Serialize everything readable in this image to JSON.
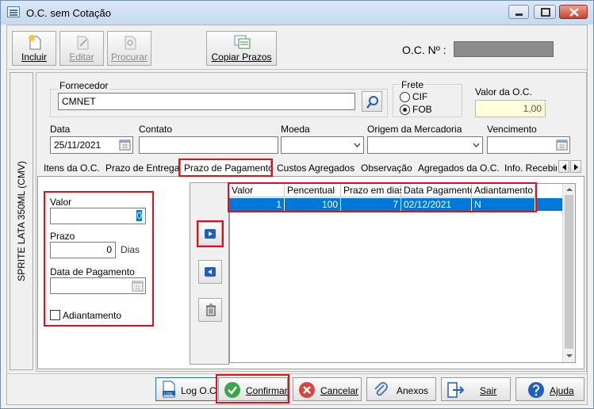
{
  "window": {
    "title": "O.C. sem Cotação"
  },
  "toolbar": {
    "incluir": "Incluir",
    "editar": "Editar",
    "procurar": "Procurar",
    "copiar_prazos": "Copiar Prazos",
    "oc_numero_label": "O.C. Nº :"
  },
  "side_label": "SPRITE LATA 350ML (CMV)",
  "form": {
    "fornecedor_label": "Fornecedor",
    "fornecedor_value": "CMNET",
    "frete_label": "Frete",
    "frete_options": [
      "CIF",
      "FOB"
    ],
    "frete_selected": "FOB",
    "valor_oc_label": "Valor da O.C.",
    "valor_oc_value": "1,00",
    "data_label": "Data",
    "data_value": "25/11/2021",
    "contato_label": "Contato",
    "contato_value": "",
    "moeda_label": "Moeda",
    "moeda_value": "",
    "origem_label": "Origem da Mercadoria",
    "origem_value": "",
    "vencimento_label": "Vencimento",
    "vencimento_value": ""
  },
  "tabs": [
    "Itens da O.C.",
    "Prazo de Entrega",
    "Prazo de Pagamento",
    "Custos Agregados",
    "Observação",
    "Agregados da O.C.",
    "Info. Recebir"
  ],
  "active_tab": "Prazo de Pagamento",
  "pagamento": {
    "valor_label": "Valor",
    "valor_value": "0",
    "prazo_label": "Prazo",
    "prazo_value": "0",
    "prazo_unit": "Dias",
    "data_pagamento_label": "Data de Pagamento",
    "data_pagamento_value": "",
    "adiantamento_label": "Adiantamento"
  },
  "grid": {
    "columns": [
      "Valor",
      "Pencentual",
      "Prazo em dias",
      "Data Pagamento",
      "Adiantamento"
    ],
    "rows": [
      [
        "1",
        "100",
        "7",
        "02/12/2021",
        "N"
      ]
    ]
  },
  "footer": {
    "log": "Log O.C",
    "confirmar": "Confirmar",
    "cancelar": "Cancelar",
    "anexos": "Anexos",
    "sair": "Sair",
    "ajuda": "Ajuda",
    "log_badge": "LOG"
  },
  "colors": {
    "selection": "#0078d7",
    "highlight": "#e0101c",
    "nav_arrow": "#1f5fbf"
  }
}
